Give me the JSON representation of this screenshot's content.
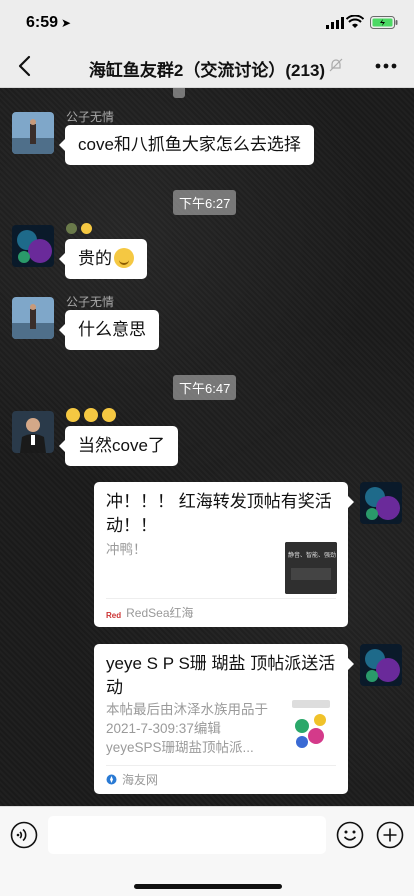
{
  "status": {
    "time": "6:59",
    "location_icon": "location-arrow-icon"
  },
  "header": {
    "title": "海缸鱼友群2（交流讨论）(213)"
  },
  "messages": [
    {
      "sender": "公子无情",
      "text": "cove和八抓鱼大家怎么去选择"
    },
    {
      "time": "下午6:27"
    },
    {
      "sender": "",
      "text": "贵的"
    },
    {
      "sender": "公子无情",
      "text": "什么意思"
    },
    {
      "time": "下午6:47"
    },
    {
      "sender": "",
      "text": "当然cove了"
    }
  ],
  "cards": [
    {
      "title": "冲！！！ 红海转发顶帖有奖活动！！",
      "desc": "冲鸭！",
      "source": "RedSea红海",
      "thumb_text": "静音、智能、强劲"
    },
    {
      "title": "yeye S P S珊 瑚盐 顶帖派送活动",
      "desc": "本帖最后由沐泽水族用品于2021-7-309:37编辑 yeyeSPS珊瑚盐顶帖派...",
      "source": "海友网"
    }
  ],
  "colors": {
    "bubble": "#ffffff",
    "chat_bg": "#1c1c1c",
    "bar": "#ededed"
  }
}
